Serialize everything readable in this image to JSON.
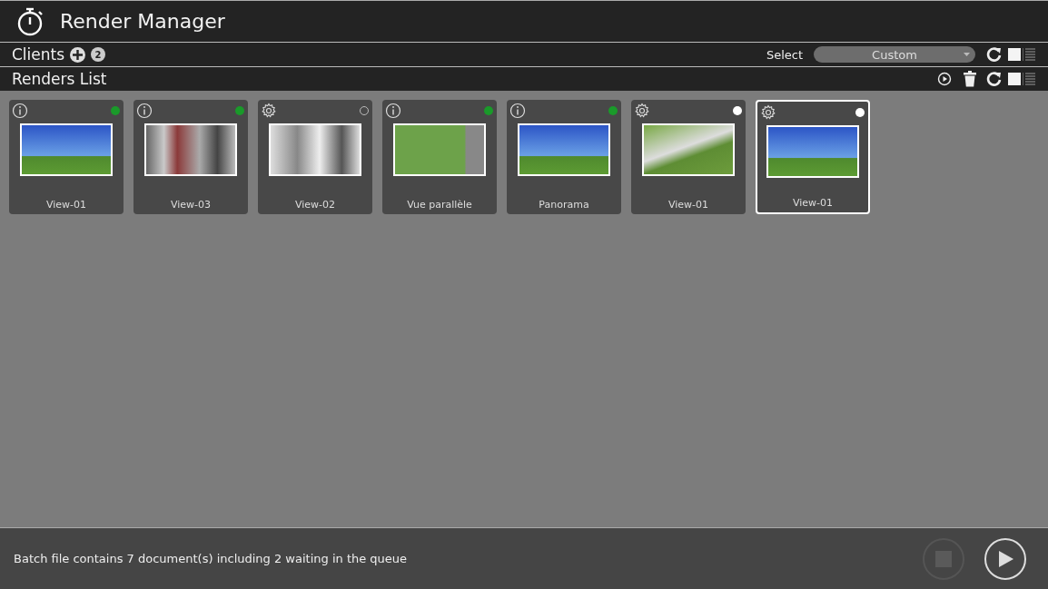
{
  "window": {
    "title": "Render Manager"
  },
  "clients": {
    "title": "Clients",
    "count": "2",
    "select_label": "Select",
    "select_value": "Custom"
  },
  "renders": {
    "title": "Renders List",
    "items": [
      {
        "name": "View-01",
        "kind": "finished",
        "color": "#1a9a2a",
        "selected": false
      },
      {
        "name": "View-03",
        "kind": "finished",
        "color": "#1a9a2a",
        "selected": false
      },
      {
        "name": "View-02",
        "kind": "pending",
        "selected": false
      },
      {
        "name": "Vue parallèle",
        "kind": "finished",
        "color": "#1a9a2a",
        "selected": false
      },
      {
        "name": "Panorama",
        "kind": "finished",
        "color": "#1a9a2a",
        "selected": false
      },
      {
        "name": "View-01",
        "kind": "pending",
        "color": "#ffffff",
        "selected": false
      },
      {
        "name": "View-01",
        "kind": "pending",
        "color": "#ffffff",
        "selected": true
      }
    ]
  },
  "status_bar": {
    "message": "Batch file contains 7 document(s) including 2 waiting in the queue",
    "stop_disabled": true,
    "play_disabled": false
  }
}
